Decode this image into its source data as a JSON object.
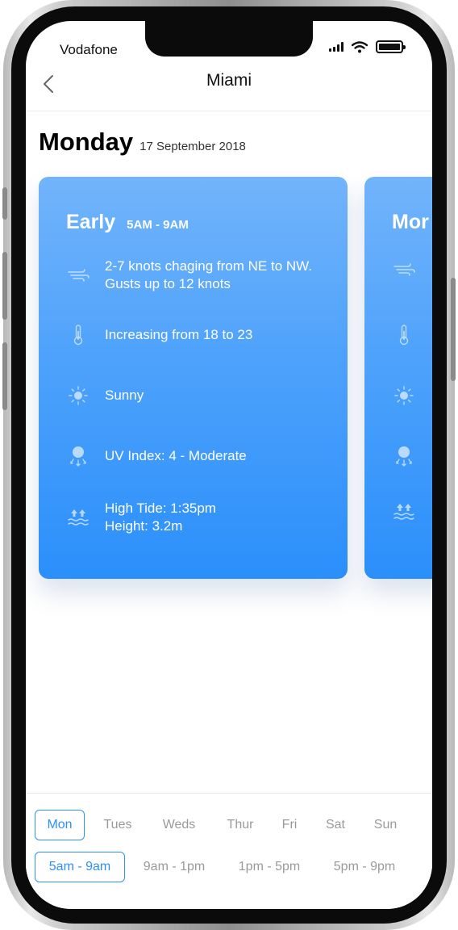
{
  "status_bar": {
    "carrier": "Vodafone"
  },
  "nav": {
    "title": "Miami"
  },
  "header": {
    "day": "Monday",
    "date": "17 September 2018"
  },
  "cards": [
    {
      "period": "Early",
      "time": "5AM - 9AM",
      "wind": "2-7 knots chaging from NE to NW. Gusts up to 12 knots",
      "temperature": "Increasing from 18 to 23",
      "sky": "Sunny",
      "uv": "UV Index: 4 - Moderate",
      "tide_line1": "High Tide: 1:35pm",
      "tide_line2": "Height: 3.2m"
    },
    {
      "period": "Mor"
    }
  ],
  "days": [
    "Mon",
    "Tues",
    "Weds",
    "Thur",
    "Fri",
    "Sat",
    "Sun"
  ],
  "selected_day": "Mon",
  "slots": [
    "5am - 9am",
    "9am - 1pm",
    "1pm - 5pm",
    "5pm - 9pm"
  ],
  "selected_slot": "5am - 9am",
  "colors": {
    "accent": "#2f8ff7",
    "card_top": "#72b4fb",
    "card_bottom": "#2b8ffb"
  },
  "icons": [
    "back-chevron-icon",
    "signal-icon",
    "wifi-icon",
    "battery-icon",
    "wind-icon",
    "thermometer-icon",
    "sun-icon",
    "uv-icon",
    "tide-icon"
  ]
}
